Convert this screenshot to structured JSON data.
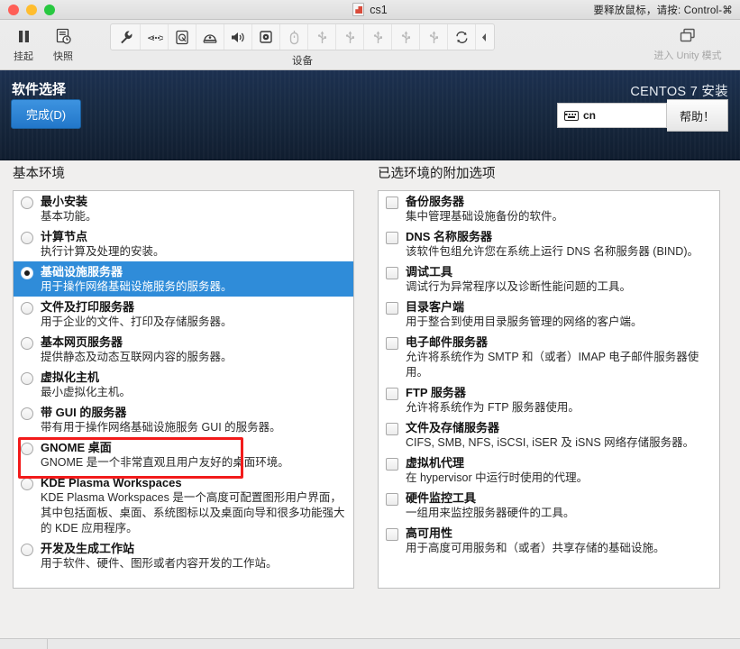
{
  "window": {
    "title": "cs1",
    "release_hint": "要释放鼠标，请按: Control-⌘",
    "doc_icon": "vm-document-icon",
    "traffic": {
      "close": "close-button",
      "minimize": "minimize-button",
      "maximize": "maximize-button"
    }
  },
  "toolbar": {
    "left_buttons": [
      {
        "label": "挂起",
        "icon": "pause-icon"
      },
      {
        "label": "快照",
        "icon": "snapshot-icon"
      }
    ],
    "device_group_label": "设备",
    "device_icons": [
      {
        "icon": "wrench-icon",
        "dim": false
      },
      {
        "icon": "network-icon",
        "dim": false
      },
      {
        "icon": "hard-disk-icon",
        "dim": false
      },
      {
        "icon": "printer-icon",
        "dim": false
      },
      {
        "icon": "speaker-icon",
        "dim": false
      },
      {
        "icon": "cd-drive-icon",
        "dim": false
      },
      {
        "icon": "mouse-icon",
        "dim": true
      },
      {
        "icon": "usb-icon",
        "dim": true
      },
      {
        "icon": "usb-icon",
        "dim": true
      },
      {
        "icon": "usb-icon",
        "dim": true
      },
      {
        "icon": "usb-icon",
        "dim": true
      },
      {
        "icon": "usb-icon",
        "dim": true
      },
      {
        "icon": "sync-icon",
        "dim": false
      }
    ],
    "collapse_icon": "collapse-left-arrow-icon",
    "unity": {
      "label": "进入 Unity 模式",
      "icon": "unity-windows-icon"
    }
  },
  "installer": {
    "screen_title": "软件选择",
    "done_label": "完成(D)",
    "product": "CENTOS 7 安装",
    "keyboard_layout": "cn",
    "keyboard_icon": "keyboard-icon",
    "help_label": "帮助！",
    "left_heading": "基本环境",
    "right_heading": "已选环境的附加选项",
    "accent_blue": "#2f8cd9",
    "header_navy": "#16273d",
    "annotation_color": "#f21b1b"
  },
  "environments": [
    {
      "name": "最小安装",
      "desc": "基本功能。",
      "selected": false
    },
    {
      "name": "计算节点",
      "desc": "执行计算及处理的安装。",
      "selected": false
    },
    {
      "name": "基础设施服务器",
      "desc": "用于操作网络基础设施服务的服务器。",
      "selected": true
    },
    {
      "name": "文件及打印服务器",
      "desc": "用于企业的文件、打印及存储服务器。",
      "selected": false
    },
    {
      "name": "基本网页服务器",
      "desc": "提供静态及动态互联网内容的服务器。",
      "selected": false
    },
    {
      "name": "虚拟化主机",
      "desc": "最小虚拟化主机。",
      "selected": false
    },
    {
      "name": "带 GUI 的服务器",
      "desc": "带有用于操作网络基础设施服务 GUI 的服务器。",
      "selected": false
    },
    {
      "name": "GNOME 桌面",
      "desc": "GNOME 是一个非常直观且用户友好的桌面环境。",
      "selected": false
    },
    {
      "name": "KDE Plasma Workspaces",
      "desc": "KDE Plasma Workspaces 是一个高度可配置图形用户界面，其中包括面板、桌面、系统图标以及桌面向导和很多功能强大的 KDE 应用程序。",
      "selected": false
    },
    {
      "name": "开发及生成工作站",
      "desc": "用于软件、硬件、图形或者内容开发的工作站。",
      "selected": false
    }
  ],
  "addons": [
    {
      "name": "备份服务器",
      "desc": "集中管理基础设施备份的软件。",
      "checked": false
    },
    {
      "name": "DNS 名称服务器",
      "desc": "该软件包组允许您在系统上运行 DNS 名称服务器 (BIND)。",
      "checked": false
    },
    {
      "name": "调试工具",
      "desc": "调试行为异常程序以及诊断性能问题的工具。",
      "checked": false
    },
    {
      "name": "目录客户端",
      "desc": "用于整合到使用目录服务管理的网络的客户端。",
      "checked": false
    },
    {
      "name": "电子邮件服务器",
      "desc": "允许将系统作为 SMTP 和（或者）IMAP 电子邮件服务器使用。",
      "checked": false
    },
    {
      "name": "FTP 服务器",
      "desc": "允许将系统作为 FTP 服务器使用。",
      "checked": false
    },
    {
      "name": "文件及存储服务器",
      "desc": "CIFS, SMB, NFS, iSCSI, iSER 及 iSNS 网络存储服务器。",
      "checked": false
    },
    {
      "name": "虚拟机代理",
      "desc": "在 hypervisor 中运行时使用的代理。",
      "checked": false
    },
    {
      "name": "硬件监控工具",
      "desc": "一组用来监控服务器硬件的工具。",
      "checked": false
    },
    {
      "name": "高可用性",
      "desc": "用于高度可用服务和（或者）共享存储的基础设施。",
      "checked": false
    }
  ]
}
